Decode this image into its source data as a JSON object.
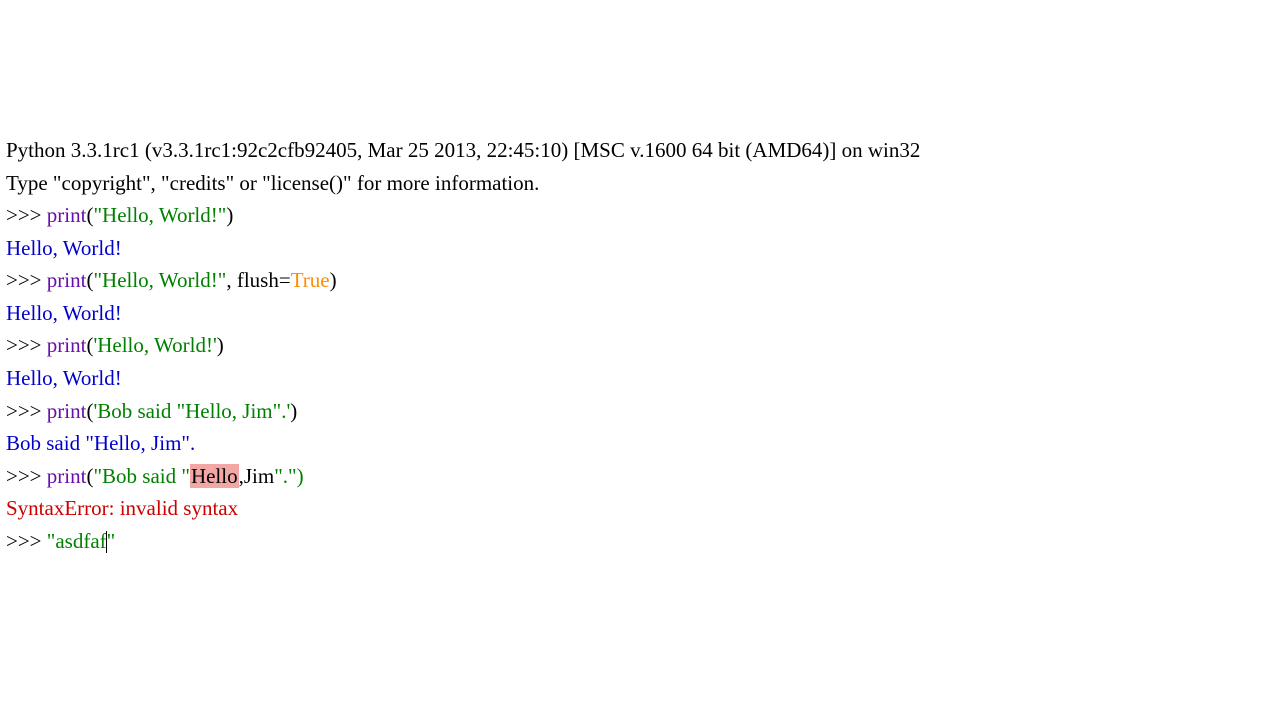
{
  "banner": {
    "line1": "Python 3.3.1rc1 (v3.3.1rc1:92c2cfb92405, Mar 25 2013, 22:45:10) [MSC v.1600 64 bit (AMD64)] on win32",
    "line2": "Type \"copyright\", \"credits\" or \"license()\" for more information."
  },
  "prompt": ">>> ",
  "entries": [
    {
      "call": "print",
      "open": "(",
      "str": "\"Hello, World!\"",
      "close": ")",
      "output": "Hello, World!"
    },
    {
      "call": "print",
      "open": "(",
      "str": "\"Hello, World!\"",
      "comma": ", ",
      "kwarg": "flush=",
      "bool": "True",
      "close": ")",
      "output": "Hello, World!"
    },
    {
      "call": "print",
      "open": "(",
      "str": "'Hello, World!'",
      "close": ")",
      "output": "Hello, World!"
    },
    {
      "call": "print",
      "open": "(",
      "str": "'Bob said \"Hello, Jim\".'",
      "close": ")",
      "output": "Bob said \"Hello, Jim\"."
    },
    {
      "call": "print",
      "open": "(",
      "str_pre": "\"Bob said \"",
      "hl": "Hello",
      "str_post": ",Jim",
      "tail": "\".\")",
      "error": "SyntaxError: invalid syntax"
    }
  ],
  "current": {
    "pre": "\"asdfaf",
    "post": "\""
  }
}
